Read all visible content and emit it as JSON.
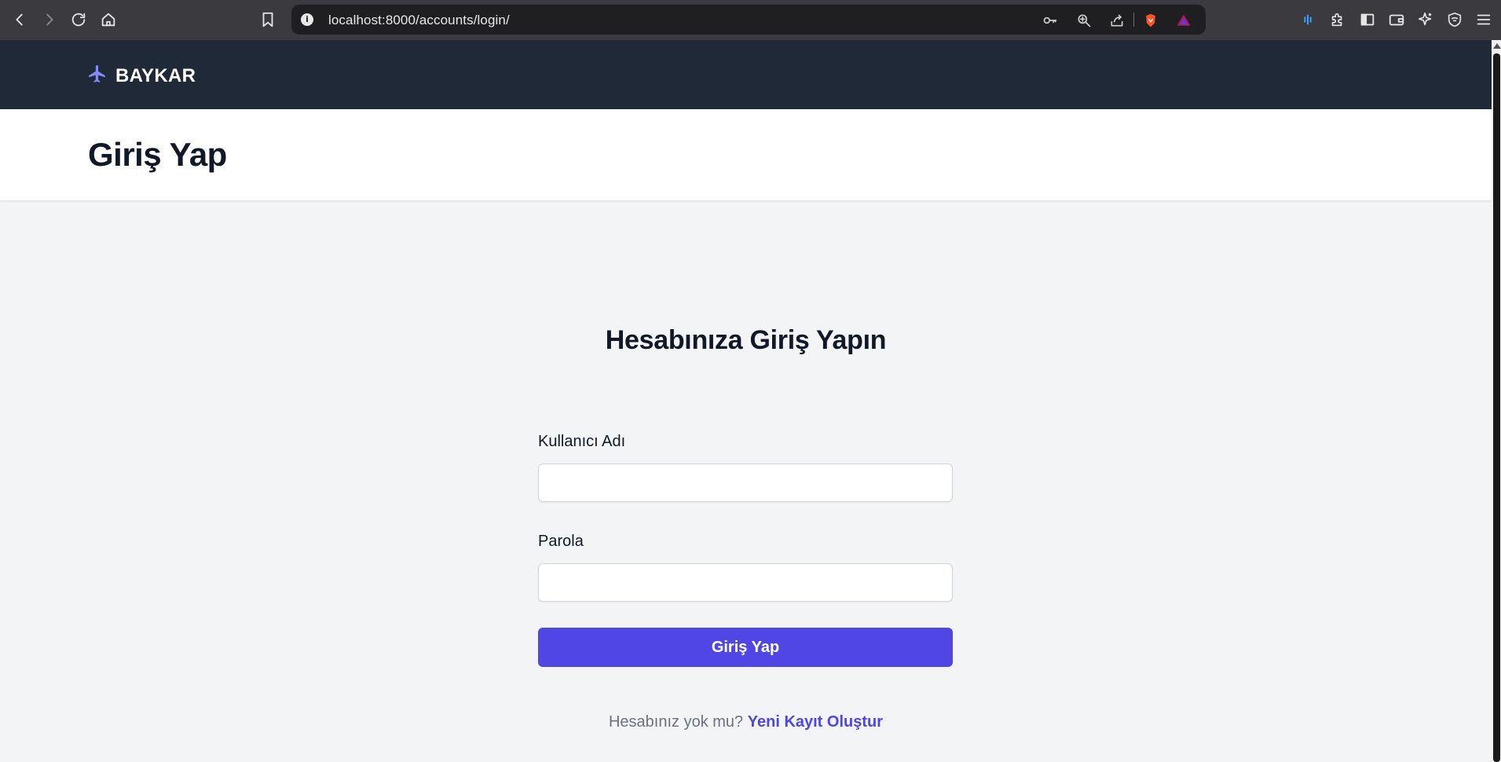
{
  "browser": {
    "url": "localhost:8000/accounts/login/",
    "info_glyph": "i",
    "icons": [
      "back-icon",
      "forward-icon",
      "reload-icon",
      "home-icon",
      "bookmark-icon",
      "site-info-icon",
      "password-key-icon",
      "zoom-icon",
      "share-icon",
      "brave-shields-icon",
      "brave-rewards-icon",
      "speech-reader-icon",
      "extensions-icon",
      "sidebar-icon",
      "wallet-icon",
      "leo-ai-icon",
      "vpn-icon",
      "menu-icon"
    ]
  },
  "navbar": {
    "brand": "BAYKAR",
    "brand_icon": "airplane-icon",
    "background": "#1f2937"
  },
  "header": {
    "title": "Giriş Yap"
  },
  "form": {
    "heading": "Hesabınıza Giriş Yapın",
    "username_label": "Kullanıcı Adı",
    "username_value": "",
    "password_label": "Parola",
    "password_value": "",
    "submit_label": "Giriş Yap",
    "signup_prompt": "Hesabınız yok mu?",
    "signup_link": "Yeni Kayıt Oluştur"
  },
  "colors": {
    "accent": "#4f46e5",
    "page_background": "#f3f4f6",
    "text_dark": "#111827",
    "text_muted": "#6b7280"
  }
}
